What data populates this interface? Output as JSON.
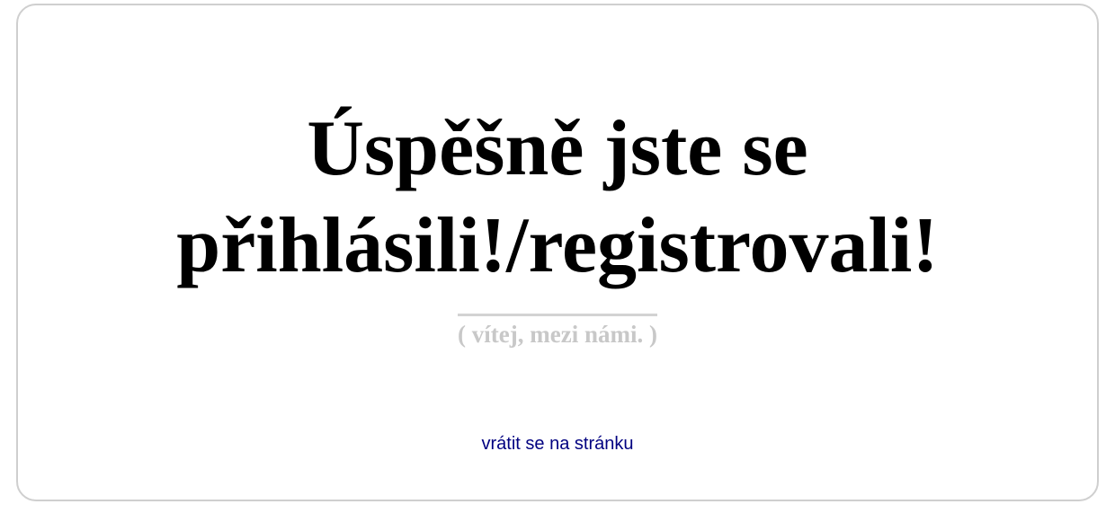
{
  "message": {
    "line1": "Úspěšně jste se",
    "line2": "přihlásili!/registrovali!",
    "subtitle": "( vítej, mezi námi. )"
  },
  "actions": {
    "back_link": "vrátit se na stránku"
  },
  "colors": {
    "heading": "#000000",
    "subtitle": "#c8c8c8",
    "link": "#000080",
    "card_border": "#cfcfcf"
  }
}
